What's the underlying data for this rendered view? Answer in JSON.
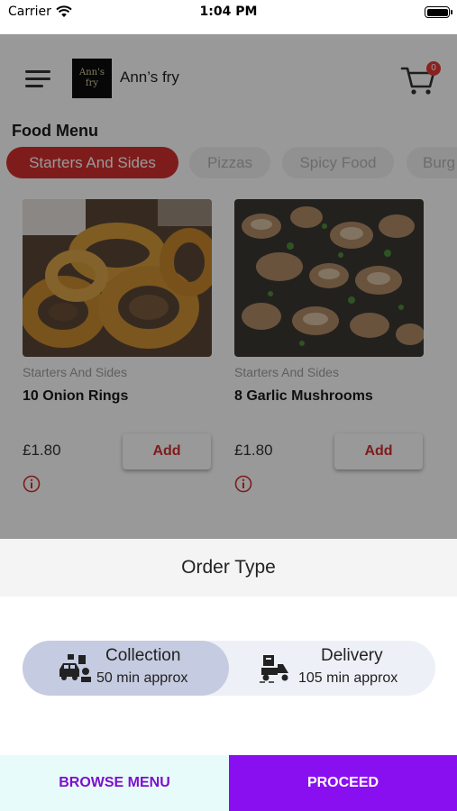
{
  "status_bar": {
    "carrier": "Carrier",
    "time": "1:04 PM",
    "icons": [
      "wifi-icon",
      "battery-icon"
    ]
  },
  "header": {
    "logo_text": "Ann's fry",
    "app_name": "Ann’s fry",
    "cart_count": "0",
    "icons": [
      "menu-icon",
      "cart-icon"
    ]
  },
  "menu": {
    "section_title": "Food Menu",
    "tabs": [
      {
        "label": "Starters And Sides",
        "active": true
      },
      {
        "label": "Pizzas",
        "active": false
      },
      {
        "label": "Spicy Food",
        "active": false
      },
      {
        "label": "Burg",
        "active": false
      }
    ],
    "items": [
      {
        "category": "Starters And Sides",
        "title": "10 Onion Rings",
        "price": "£1.80",
        "add_label": "Add",
        "image": "onion-rings-photo"
      },
      {
        "category": "Starters And Sides",
        "title": "8 Garlic Mushrooms",
        "price": "£1.80",
        "add_label": "Add",
        "image": "garlic-mushrooms-photo"
      }
    ]
  },
  "order_type": {
    "title": "Order Type",
    "options": [
      {
        "label": "Collection",
        "sub": "50 min approx",
        "selected": true,
        "icon": "collection-car-icon"
      },
      {
        "label": "Delivery",
        "sub": "105 min approx",
        "selected": false,
        "icon": "delivery-scooter-icon"
      }
    ]
  },
  "actions": {
    "browse_label": "BROWSE MENU",
    "proceed_label": "PROCEED"
  },
  "colors": {
    "accent_red": "#d32f2f",
    "purple": "#8a0ff0",
    "selected_option": "#c5cbe0"
  }
}
